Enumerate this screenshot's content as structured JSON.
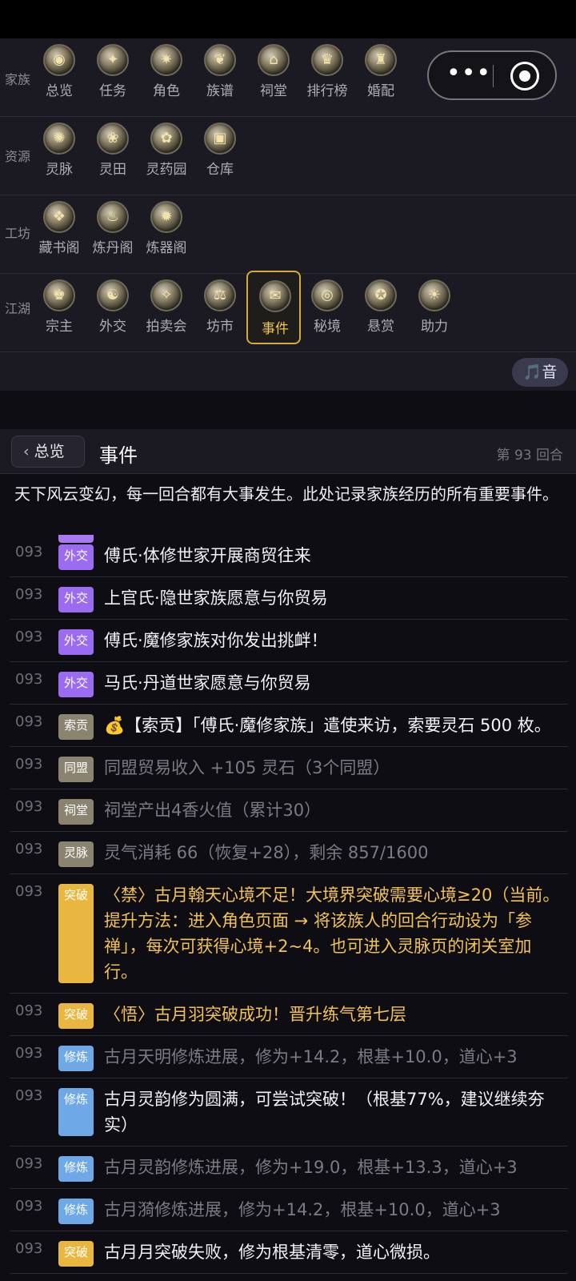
{
  "nav": {
    "rows": [
      {
        "label": "家族",
        "items": [
          {
            "label": "总览",
            "icon": "overview-icon",
            "glyph": "◉"
          },
          {
            "label": "任务",
            "icon": "task-icon",
            "glyph": "✦"
          },
          {
            "label": "角色",
            "icon": "character-icon",
            "glyph": "✷"
          },
          {
            "label": "族谱",
            "icon": "genealogy-icon",
            "glyph": "❦"
          },
          {
            "label": "祠堂",
            "icon": "shrine-icon",
            "glyph": "⌂"
          },
          {
            "label": "排行榜",
            "icon": "ranking-icon",
            "glyph": "♛"
          },
          {
            "label": "婚配",
            "icon": "marriage-icon",
            "glyph": "♜"
          }
        ]
      },
      {
        "label": "资源",
        "items": [
          {
            "label": "灵脉",
            "icon": "spirit-vein-icon",
            "glyph": "✺"
          },
          {
            "label": "灵田",
            "icon": "spirit-field-icon",
            "glyph": "❀"
          },
          {
            "label": "灵药园",
            "icon": "herb-garden-icon",
            "glyph": "✿"
          },
          {
            "label": "仓库",
            "icon": "warehouse-icon",
            "glyph": "▣"
          }
        ]
      },
      {
        "label": "工坊",
        "items": [
          {
            "label": "藏书阁",
            "icon": "library-icon",
            "glyph": "❖"
          },
          {
            "label": "炼丹阁",
            "icon": "alchemy-icon",
            "glyph": "♨"
          },
          {
            "label": "炼器阁",
            "icon": "forge-icon",
            "glyph": "✹"
          }
        ]
      },
      {
        "label": "江湖",
        "items": [
          {
            "label": "宗主",
            "icon": "sect-master-icon",
            "glyph": "♚"
          },
          {
            "label": "外交",
            "icon": "diplomacy-icon",
            "glyph": "☯"
          },
          {
            "label": "拍卖会",
            "icon": "auction-icon",
            "glyph": "✧"
          },
          {
            "label": "坊市",
            "icon": "market-icon",
            "glyph": "⚖"
          },
          {
            "label": "事件",
            "icon": "event-icon",
            "glyph": "✉"
          },
          {
            "label": "秘境",
            "icon": "secret-realm-icon",
            "glyph": "◎"
          },
          {
            "label": "悬赏",
            "icon": "bounty-icon",
            "glyph": "✪"
          },
          {
            "label": "助力",
            "icon": "assist-icon",
            "glyph": "☀"
          }
        ]
      }
    ],
    "active": "事件",
    "sound_label": "🎵音"
  },
  "header": {
    "back_label": "总览",
    "title": "事件",
    "round": "第 93 回合"
  },
  "intro": "天下风云变幻，每一回合都有大事发生。此处记录家族经历的所有重要事件。",
  "events": [
    {
      "round": "093",
      "tag": "外交",
      "kind": "ext",
      "style": "normal",
      "text": "傅氏·体修世家开展商贸往来"
    },
    {
      "round": "093",
      "tag": "外交",
      "kind": "ext",
      "style": "normal",
      "text": "上官氏·隐世家族愿意与你贸易"
    },
    {
      "round": "093",
      "tag": "外交",
      "kind": "ext",
      "style": "normal",
      "text": "傅氏·魔修家族对你发出挑衅！"
    },
    {
      "round": "093",
      "tag": "外交",
      "kind": "ext",
      "style": "normal",
      "text": "马氏·丹道世家愿意与你贸易"
    },
    {
      "round": "093",
      "tag": "索贡",
      "kind": "gray",
      "style": "normal",
      "text": "💰【索贡】「傅氏·魔修家族」遣使来访，索要灵石 500 枚。"
    },
    {
      "round": "093",
      "tag": "同盟",
      "kind": "gray",
      "style": "dim",
      "text": "同盟贸易收入 +105 灵石（3个同盟）"
    },
    {
      "round": "093",
      "tag": "祠堂",
      "kind": "gray",
      "style": "dim",
      "text": "祠堂产出4香火值（累计30）"
    },
    {
      "round": "093",
      "tag": "灵脉",
      "kind": "gray",
      "style": "dim",
      "text": "灵气消耗 66（恢复+28），剩余 857/1600"
    },
    {
      "round": "093",
      "tag": "突破",
      "kind": "brk",
      "style": "warn",
      "text": "〈禁〉古月翰天心境不足！大境界突破需要心境≥20（当前。提升方法：进入角色页面 → 将该族人的回合行动设为「参禅」，每次可获得心境+2~4。也可进入灵脉页的闭关室加行。"
    },
    {
      "round": "093",
      "tag": "突破",
      "kind": "brk",
      "style": "warn",
      "text": "〈悟〉古月羽突破成功！晋升练气第七层"
    },
    {
      "round": "093",
      "tag": "修炼",
      "kind": "cult",
      "style": "dim",
      "text": "古月天明修炼进展，修为+14.2，根基+10.0，道心+3"
    },
    {
      "round": "093",
      "tag": "修炼",
      "kind": "cult",
      "style": "normal",
      "text": "古月灵韵修为圆满，可尝试突破！（根基77%，建议继续夯实）"
    },
    {
      "round": "093",
      "tag": "修炼",
      "kind": "cult",
      "style": "dim",
      "text": "古月灵韵修炼进展，修为+19.0，根基+13.3，道心+3"
    },
    {
      "round": "093",
      "tag": "修炼",
      "kind": "cult",
      "style": "dim",
      "text": "古月漪修炼进展，修为+14.2，根基+10.0，道心+3"
    },
    {
      "round": "093",
      "tag": "突破",
      "kind": "brk",
      "style": "normal",
      "text": "古月月突破失败，修为根基清零，道心微损。"
    }
  ]
}
